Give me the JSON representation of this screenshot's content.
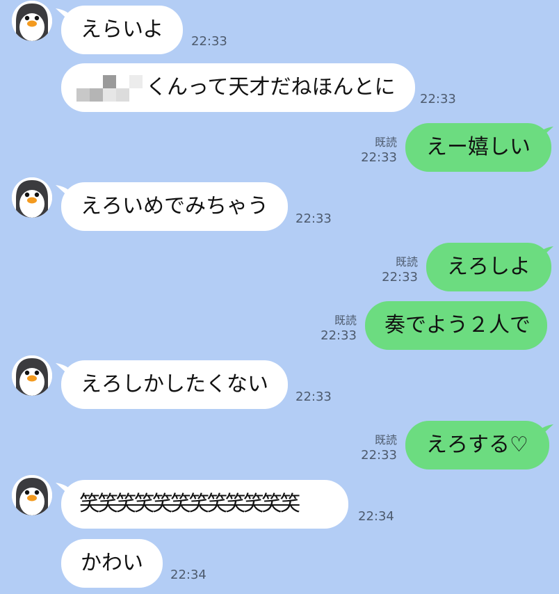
{
  "messages": [
    {
      "text": "えらいよ",
      "time": "22:33"
    },
    {
      "text": "くんって天才だねほんとに",
      "time": "22:33"
    },
    {
      "read": "既読",
      "text": "えー嬉しい",
      "time": "22:33"
    },
    {
      "text": "えろいめでみちゃう",
      "time": "22:33"
    },
    {
      "read": "既読",
      "text": "えろしよ",
      "time": "22:33"
    },
    {
      "read": "既読",
      "text": "奏でよう２人で",
      "time": "22:33"
    },
    {
      "text": "えろしかしたくない",
      "time": "22:33"
    },
    {
      "read": "既読",
      "text": "えろする♡",
      "time": "22:33"
    },
    {
      "text": "笑笑笑笑笑笑笑笑笑笑笑笑",
      "time": "22:34"
    },
    {
      "text": "かわい",
      "time": "22:34"
    }
  ],
  "colors": {
    "background": "#b3cdf5",
    "incoming": "#ffffff",
    "outgoing": "#6cdc80"
  },
  "icons": {
    "avatar": "penguin-avatar-icon"
  }
}
